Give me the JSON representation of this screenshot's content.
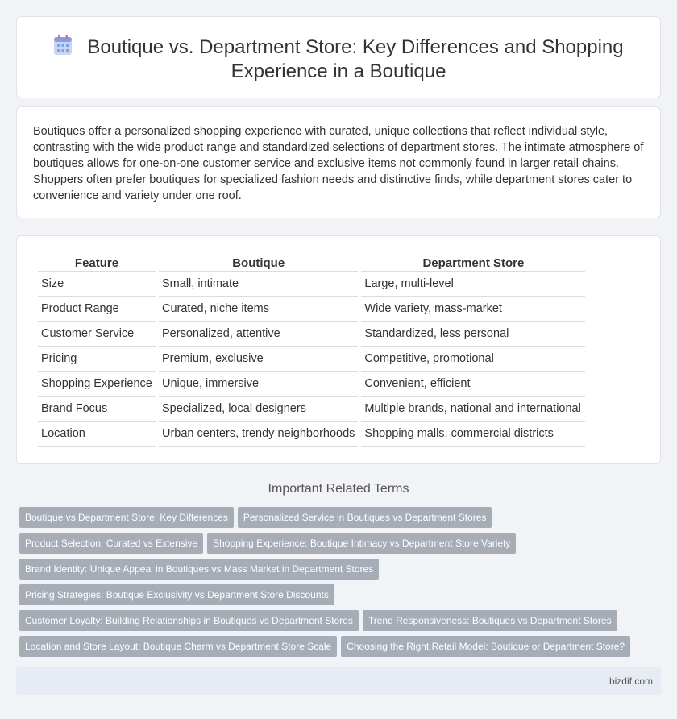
{
  "header": {
    "icon": "calendar-icon",
    "title": "Boutique vs. Department Store: Key Differences and Shopping Experience in a Boutique"
  },
  "intro": {
    "text": "Boutiques offer a personalized shopping experience with curated, unique collections that reflect individual style, contrasting with the wide product range and standardized selections of department stores. The intimate atmosphere of boutiques allows for one-on-one customer service and exclusive items not commonly found in larger retail chains. Shoppers often prefer boutiques for specialized fashion needs and distinctive finds, while department stores cater to convenience and variety under one roof."
  },
  "table": {
    "headers": [
      "Feature",
      "Boutique",
      "Department Store"
    ],
    "rows": [
      [
        "Size",
        "Small, intimate",
        "Large, multi-level"
      ],
      [
        "Product Range",
        "Curated, niche items",
        "Wide variety, mass-market"
      ],
      [
        "Customer Service",
        "Personalized, attentive",
        "Standardized, less personal"
      ],
      [
        "Pricing",
        "Premium, exclusive",
        "Competitive, promotional"
      ],
      [
        "Shopping Experience",
        "Unique, immersive",
        "Convenient, efficient"
      ],
      [
        "Brand Focus",
        "Specialized, local designers",
        "Multiple brands, national and international"
      ],
      [
        "Location",
        "Urban centers, trendy neighborhoods",
        "Shopping malls, commercial districts"
      ]
    ]
  },
  "related": {
    "title": "Important Related Terms",
    "rows": [
      [
        "Boutique vs Department Store: Key Differences",
        "Personalized Service in Boutiques vs Department Stores"
      ],
      [
        "Product Selection: Curated vs Extensive",
        "Shopping Experience: Boutique Intimacy vs Department Store Variety"
      ],
      [
        "Brand Identity: Unique Appeal in Boutiques vs Mass Market in Department Stores"
      ],
      [
        "Pricing Strategies: Boutique Exclusivity vs Department Store Discounts"
      ],
      [
        "Customer Loyalty: Building Relationships in Boutiques vs Department Stores",
        "Trend Responsiveness: Boutiques vs Department Stores"
      ],
      [
        "Location and Store Layout: Boutique Charm vs Department Store Scale",
        "Choosing the Right Retail Model: Boutique or Department Store?"
      ]
    ]
  },
  "footer": {
    "site": "bizdif.com"
  },
  "colors": {
    "tag_bg": "#a6adb7",
    "page_bg": "#f1f3f6",
    "footer_bg": "#e7ecf4"
  }
}
